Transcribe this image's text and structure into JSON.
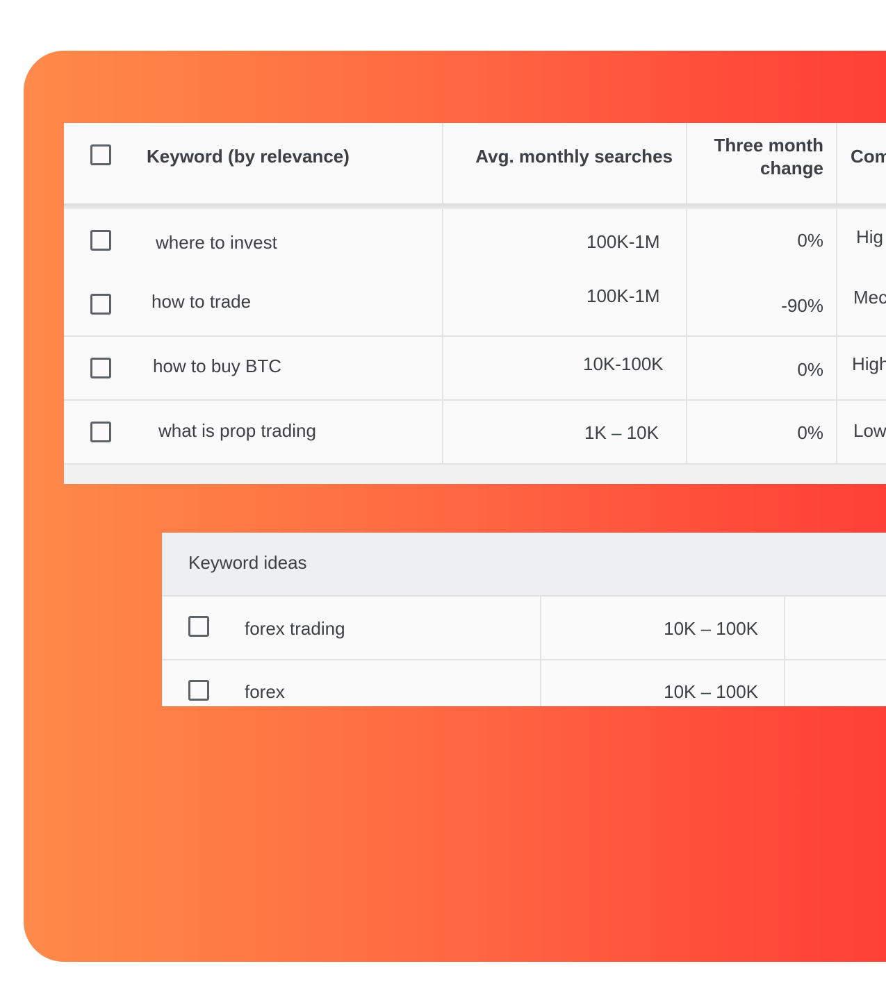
{
  "keyword_table": {
    "headers": {
      "keyword": "Keyword (by relevance)",
      "searches": "Avg. monthly searches",
      "change_line1": "Three month",
      "change_line2": "change",
      "competition": "Com"
    },
    "rows": [
      {
        "keyword": "where to invest",
        "searches": "100K-1M",
        "change": "0%",
        "competition": "Hig"
      },
      {
        "keyword": "how to trade",
        "searches": "100K-1M",
        "change": "-90%",
        "competition": "Mec"
      },
      {
        "keyword": "how to buy BTC",
        "searches": "10K-100K",
        "change": "0%",
        "competition": "High"
      },
      {
        "keyword": "what is prop trading",
        "searches": "1K – 10K",
        "change": "0%",
        "competition": "Low"
      }
    ]
  },
  "keyword_ideas": {
    "title": "Keyword ideas",
    "rows": [
      {
        "keyword": "forex trading",
        "searches": "10K – 100K"
      },
      {
        "keyword": "forex",
        "searches": "10K – 100K"
      }
    ]
  },
  "colors": {
    "gradient_start": "#ff8a4a",
    "gradient_end": "#ff3f36",
    "table_bg": "#fafafa",
    "text": "#3c4043"
  }
}
